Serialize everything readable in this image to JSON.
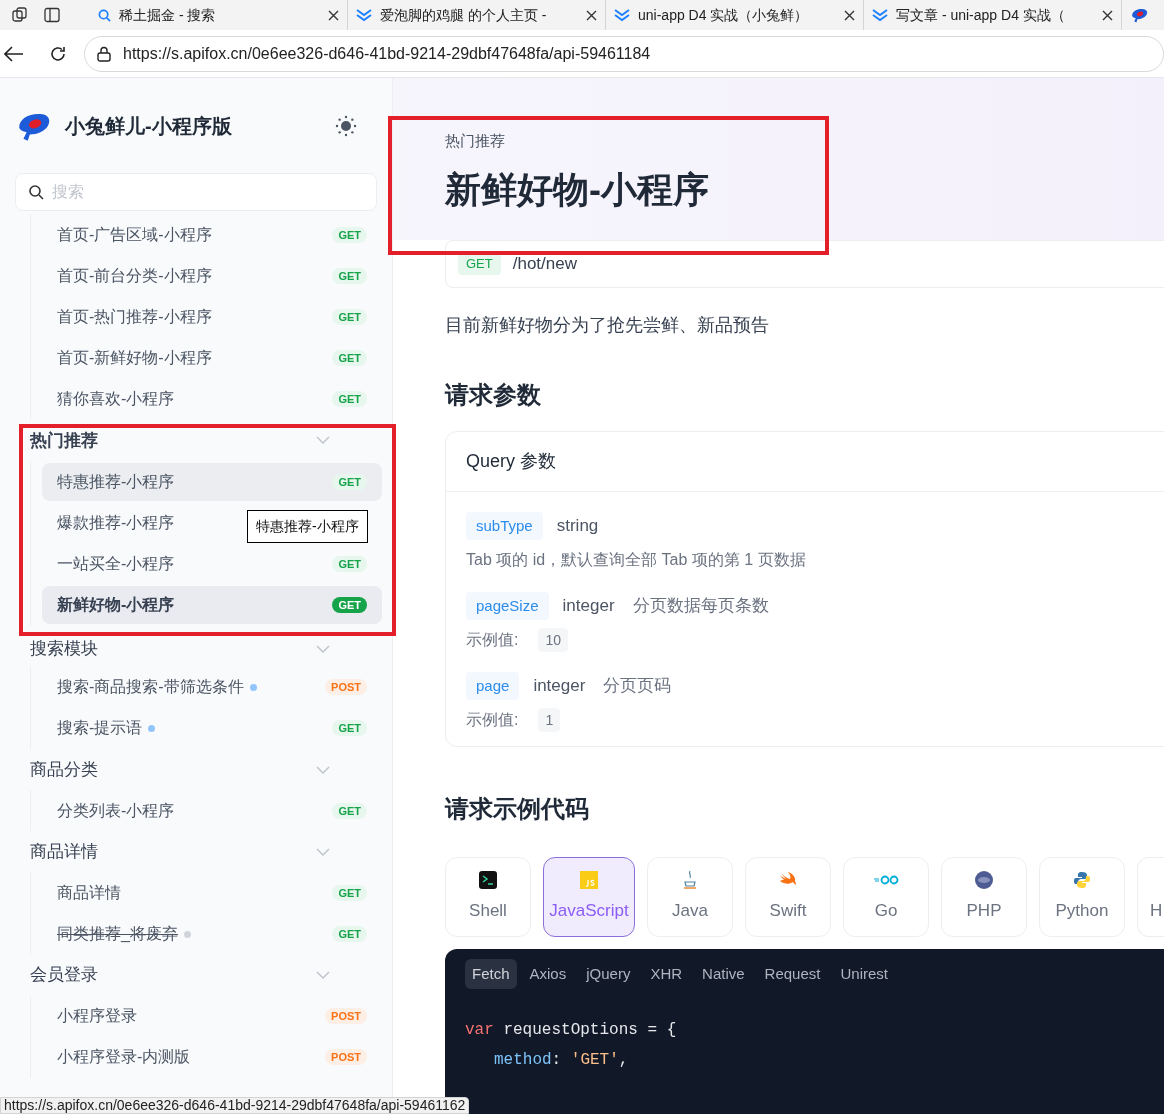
{
  "browser": {
    "tabs": [
      {
        "title": "稀土掘金 - 搜索",
        "selected": false
      },
      {
        "title": "爱泡脚的鸡腿 的个人主页 -",
        "selected": false
      },
      {
        "title": "uni-app D4 实战（小兔鲜）",
        "selected": false
      },
      {
        "title": "写文章 - uni-app D4 实战（",
        "selected": false
      }
    ],
    "url": "https://s.apifox.cn/0e6ee326-d646-41bd-9214-29dbf47648fa/api-59461184",
    "status_url": "https://s.apifox.cn/0e6ee326-d646-41bd-9214-29dbf47648fa/api-59461162"
  },
  "sidebar": {
    "title": "小兔鲜儿-小程序版",
    "search": {
      "placeholder": "搜索"
    },
    "groups": [
      {
        "items": [
          {
            "name": "首页-广告区域-小程序",
            "method": "GET",
            "selected": false,
            "hovered": false,
            "deprecated": false
          },
          {
            "name": "首页-前台分类-小程序",
            "method": "GET",
            "selected": false,
            "hovered": false,
            "deprecated": false
          },
          {
            "name": "首页-热门推荐-小程序",
            "method": "GET",
            "selected": false,
            "hovered": false,
            "deprecated": false
          },
          {
            "name": "首页-新鲜好物-小程序",
            "method": "GET",
            "selected": false,
            "hovered": false,
            "deprecated": false
          },
          {
            "name": "猜你喜欢-小程序",
            "method": "GET",
            "selected": false,
            "hovered": false,
            "deprecated": false
          }
        ]
      },
      {
        "name": "热门推荐",
        "expanded": true,
        "items": [
          {
            "name": "特惠推荐-小程序",
            "method": "GET",
            "selected": false,
            "hovered": true,
            "deprecated": false
          },
          {
            "name": "爆款推荐-小程序",
            "selected": false,
            "hovered": false,
            "deprecated": false
          },
          {
            "name": "一站买全-小程序",
            "method": "GET",
            "selected": false,
            "hovered": false,
            "deprecated": false
          },
          {
            "name": "新鲜好物-小程序",
            "method": "GET",
            "selected": true,
            "hovered": false,
            "deprecated": false
          }
        ]
      },
      {
        "name": "搜索模块",
        "expanded": true,
        "items": [
          {
            "name": "搜索-商品搜索-带筛选条件",
            "method": "POST",
            "selected": false,
            "hovered": false,
            "deprecated": false,
            "color": "#93c5fd"
          },
          {
            "name": "搜索-提示语",
            "method": "GET",
            "selected": false,
            "hovered": false,
            "deprecated": false,
            "color": "#93c5fd"
          }
        ]
      },
      {
        "name": "商品分类",
        "expanded": true,
        "items": [
          {
            "name": "分类列表-小程序",
            "method": "GET",
            "selected": false,
            "hovered": false,
            "deprecated": false
          }
        ]
      },
      {
        "name": "商品详情",
        "expanded": true,
        "items": [
          {
            "name": "商品详情",
            "method": "GET",
            "selected": false,
            "hovered": false,
            "deprecated": false
          },
          {
            "name": "同类推荐_将废弃",
            "method": "GET",
            "selected": false,
            "hovered": false,
            "deprecated": true,
            "color": "#d1d5db"
          }
        ]
      },
      {
        "name": "会员登录",
        "expanded": true,
        "items": [
          {
            "name": "小程序登录",
            "method": "POST",
            "selected": false,
            "hovered": false,
            "deprecated": false
          },
          {
            "name": "小程序登录-内测版",
            "method": "POST",
            "selected": false,
            "hovered": false,
            "deprecated": false
          }
        ]
      }
    ],
    "tooltip": "特惠推荐-小程序"
  },
  "main": {
    "breadcrumb": "热门推荐",
    "title": "新鲜好物-小程序",
    "method": "GET",
    "path": "/hot/new",
    "description": "目前新鲜好物分为了抢先尝鲜、新品预告",
    "params_heading": "请求参数",
    "params_card_title": "Query 参数",
    "params": [
      {
        "name": "subType",
        "type": "string",
        "description": "Tab 项的 id，默认查询全部 Tab 项的第 1 页数据"
      },
      {
        "name": "pageSize",
        "type": "integer",
        "summary": "分页数据每页条数",
        "example_label": "示例值:",
        "example": "10"
      },
      {
        "name": "page",
        "type": "integer",
        "summary": "分页页码",
        "example_label": "示例值:",
        "example": "1"
      }
    ],
    "code_heading": "请求示例代码",
    "languages": [
      {
        "label": "Shell",
        "selected": false
      },
      {
        "label": "JavaScript",
        "selected": true
      },
      {
        "label": "Java",
        "selected": false
      },
      {
        "label": "Swift",
        "selected": false
      },
      {
        "label": "Go",
        "selected": false
      },
      {
        "label": "PHP",
        "selected": false
      },
      {
        "label": "Python",
        "selected": false
      },
      {
        "label": "H",
        "selected": false
      }
    ],
    "code_tabs": [
      {
        "label": "Fetch",
        "selected": true
      },
      {
        "label": "Axios",
        "selected": false
      },
      {
        "label": "jQuery",
        "selected": false
      },
      {
        "label": "XHR",
        "selected": false
      },
      {
        "label": "Native",
        "selected": false
      },
      {
        "label": "Request",
        "selected": false
      },
      {
        "label": "Unirest",
        "selected": false
      }
    ],
    "code_lines": [
      [
        {
          "kind": "keyword",
          "text": "var"
        },
        {
          "kind": "plain",
          "text": " requestOptions = {"
        }
      ],
      [
        {
          "kind": "property",
          "text": "method"
        },
        {
          "kind": "plain",
          "text": ": "
        },
        {
          "kind": "string",
          "text": "'GET'"
        },
        {
          "kind": "plain",
          "text": ","
        }
      ]
    ]
  }
}
